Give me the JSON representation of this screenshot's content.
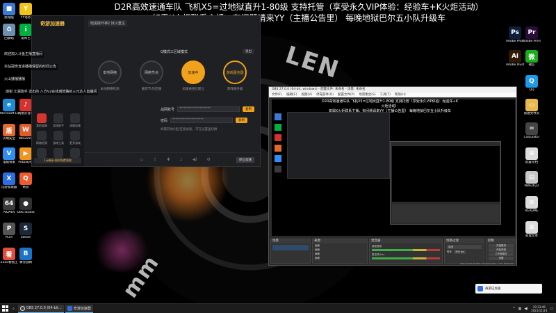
{
  "banner": {
    "line1": "D2R高效速通车队 飞机X5=过地狱直升1-80级 支持托管（享受永久VIP体验：经验车+K火炬活动）",
    "line2": "如需K火炬联系主播，有问题请来YY（主播公告里） 每晚地狱巴尔五小队升级车"
  },
  "wallpaper": {
    "lens_text_1": "LEN",
    "lens_text_2": "mm"
  },
  "desktop_left": [
    {
      "label": "此电脑",
      "color": "#3b7bd4",
      "glyph": "■"
    },
    {
      "label": "YY语音",
      "color": "#f0c419",
      "glyph": "Y"
    },
    {
      "label": "回收站",
      "color": "#6c8fb0",
      "glyph": "♻"
    },
    {
      "label": "爱奇艺",
      "color": "#00b140",
      "glyph": "i"
    },
    {
      "label": "Microsoft Edge",
      "color": "#1f8ad6",
      "glyph": "e"
    },
    {
      "label": "网易云音乐",
      "color": "#d4312f",
      "glyph": "♪"
    },
    {
      "label": "火绒安全",
      "color": "#e2682b",
      "glyph": "盾"
    },
    {
      "label": "WeGame",
      "color": "#e05a2a",
      "glyph": "W"
    },
    {
      "label": "电脑管家",
      "color": "#2f8ef4",
      "glyph": "V"
    },
    {
      "label": "Potplayer",
      "color": "#f29422",
      "glyph": "▶"
    },
    {
      "label": "迅游加速器",
      "color": "#2c6fe0",
      "glyph": "X"
    },
    {
      "label": "奇游",
      "color": "#ef5a2f",
      "glyph": "Q"
    },
    {
      "label": "AIDA64",
      "color": "#3a3a3a",
      "glyph": "64"
    },
    {
      "label": "OBS Studio",
      "color": "#303030",
      "glyph": "●"
    },
    {
      "label": "PLSY",
      "color": "#555",
      "glyph": "P"
    },
    {
      "label": "Steam",
      "color": "#1b2838",
      "glyph": "S"
    },
    {
      "label": "2345看图王",
      "color": "#e34c3a",
      "glyph": "看"
    },
    {
      "label": "暴雪战网",
      "color": "#1a73c7",
      "glyph": "B"
    }
  ],
  "desktop_right": [
    {
      "label": "Adobe Photoshop",
      "color": "#0c1f3d",
      "glyph": "Ps"
    },
    {
      "label": "Adobe Premiere",
      "color": "#2a0b3a",
      "glyph": "Pr"
    },
    {
      "label": "Adobe Illustrator",
      "color": "#2f1a05",
      "glyph": "Ai"
    },
    {
      "label": "微信",
      "color": "#1aad19",
      "glyph": "微"
    },
    {
      "label": "QQ",
      "color": "#1e9be8",
      "glyph": "Q"
    },
    {
      "label": "新建文件夹",
      "color": "#e8b84a",
      "glyph": "▭"
    },
    {
      "label": "Calculator",
      "color": "#444",
      "glyph": "="
    },
    {
      "label": "配置文档",
      "color": "#dcdcdc",
      "glyph": "≡"
    },
    {
      "label": "NBA2K22",
      "color": "#c8c8c8",
      "glyph": "▤"
    },
    {
      "label": "README",
      "color": "#dcdcdc",
      "glyph": "≡"
    },
    {
      "label": "新建文本",
      "color": "#dcdcdc",
      "glyph": "≡"
    }
  ],
  "app": {
    "logo": "奇游加速器",
    "top_game": "暗黑破坏神2 狱火重生",
    "mode": "Q模式三区域模式",
    "action": "退出",
    "nodes": [
      {
        "label": "本地网络",
        "caption": "本地网络检测"
      },
      {
        "label": "网络节点",
        "caption": "推荐节点/区服"
      },
      {
        "label": "加速中",
        "caption": "加速通道已建立"
      },
      {
        "label": "游戏服务器",
        "caption": "游戏服务器"
      }
    ],
    "form": {
      "account_label": "战网账号",
      "account_value": "********************",
      "account_btn": "复制",
      "password_label": "密码",
      "password_value": "********************",
      "password_btn": "复制",
      "hint": "如需其他Q型/区服加速，可在设置里切换"
    },
    "tools": [
      "我的道具",
      "游戏助手",
      "流量加速",
      "网络检测",
      "游戏工具",
      "更多游戏",
      "加速记录",
      "联系客服",
      "账号设置"
    ],
    "bottom_btn": "停止加速",
    "ad": "1元畅享·限时免费领取"
  },
  "chat": [
    "欢迎加入斗鱼主播直播间",
    "本站冠命宣讲播播保留的时间公告",
    "火山播播播播",
    "感谢 江湖炮手 送出的 八方V2在线城管路的三元达人直播间"
  ],
  "obs": {
    "title": "OBS 27.0.0 (64-bit, windows) - 配置文件: 未命名 - 场景: 未命名",
    "menu": [
      "文件(F)",
      "编辑(E)",
      "视图(V)",
      "停靠部件(D)",
      "配置文件(P)",
      "场景集合(S)",
      "工具(T)",
      "帮助(H)"
    ],
    "docks": {
      "scenes": "场景",
      "sources": "来源",
      "mixer": "混音器",
      "transitions": "场景过渡",
      "controls": "控制"
    },
    "sources": [
      "画面",
      "画面",
      "画面",
      "画面"
    ],
    "mixer": [
      "桌面音频",
      "麦克风/Aux"
    ],
    "transition": "淡出",
    "duration_label": "时长",
    "duration": "300 ms",
    "controls": [
      "开始推流",
      "开始录制",
      "工作室模式",
      "设置",
      "退出"
    ],
    "status": "LIVE: 00:00:00   REC: 00:00:00   CPU: 2.4%, 60.00 fps"
  },
  "taskbar": {
    "apps": [
      "OBS 27.0.0 (64-bit...",
      "奇游加速器"
    ],
    "time": "19:23:49",
    "date": "2021/11/24"
  },
  "notification": "奇游已加速"
}
